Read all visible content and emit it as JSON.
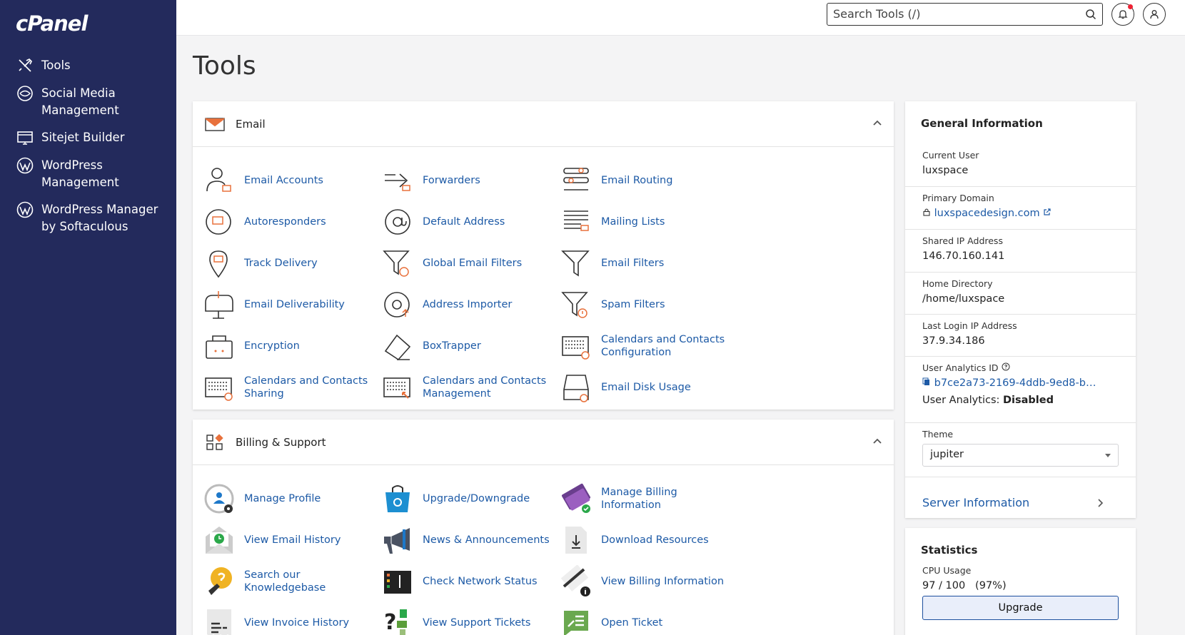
{
  "brand": {
    "logo": "cPanel"
  },
  "sidebar": {
    "items": [
      {
        "label": "Tools",
        "icon": "tools-icon"
      },
      {
        "label": "Social Media Management",
        "icon": "social-media-icon"
      },
      {
        "label": "Sitejet Builder",
        "icon": "sitejet-icon"
      },
      {
        "label": "WordPress Management",
        "icon": "wordpress-icon"
      },
      {
        "label": "WordPress Manager by Softaculous",
        "icon": "wordpress-icon"
      }
    ]
  },
  "topbar": {
    "search_placeholder": "Search Tools (/)"
  },
  "page": {
    "title": "Tools"
  },
  "email": {
    "title": "Email",
    "tools": [
      "Email Accounts",
      "Forwarders",
      "Email Routing",
      "Autoresponders",
      "Default Address",
      "Mailing Lists",
      "Track Delivery",
      "Global Email Filters",
      "Email Filters",
      "Email Deliverability",
      "Address Importer",
      "Spam Filters",
      "Encryption",
      "BoxTrapper",
      "Calendars and Contacts Configuration",
      "Calendars and Contacts Sharing",
      "Calendars and Contacts Management",
      "Email Disk Usage"
    ]
  },
  "billing": {
    "title": "Billing & Support",
    "tools": [
      "Manage Profile",
      "Upgrade/Downgrade",
      "Manage Billing Information",
      "View Email History",
      "News & Announcements",
      "Download Resources",
      "Search our Knowledgebase",
      "Check Network Status",
      "View Billing Information",
      "View Invoice History",
      "View Support Tickets",
      "Open Ticket"
    ]
  },
  "general": {
    "title": "General Information",
    "current_user_label": "Current User",
    "current_user": "luxspace",
    "primary_domain_label": "Primary Domain",
    "primary_domain": "luxspacedesign.com",
    "shared_ip_label": "Shared IP Address",
    "shared_ip": "146.70.160.141",
    "home_dir_label": "Home Directory",
    "home_dir": "/home/luxspace",
    "last_login_label": "Last Login IP Address",
    "last_login": "37.9.34.186",
    "analytics_id_label": "User Analytics ID",
    "analytics_id": "b7ce2a73-2169-4ddb-9ed8-b…",
    "analytics_status_label": "User Analytics:",
    "analytics_status": "Disabled",
    "theme_label": "Theme",
    "theme": "jupiter",
    "server_info": "Server Information"
  },
  "statistics": {
    "title": "Statistics",
    "cpu_label": "CPU Usage",
    "cpu_value": "97 / 100   (97%)",
    "upgrade": "Upgrade"
  },
  "colors": {
    "sidebar": "#232a5c",
    "link": "#1d5aa6",
    "accent_orange": "#e8713c"
  }
}
